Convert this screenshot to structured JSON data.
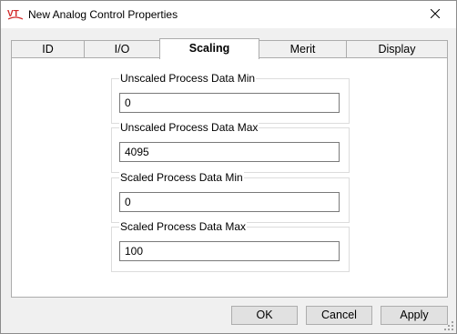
{
  "window": {
    "title": "New Analog Control Properties",
    "app_icon": "vt-logo-icon",
    "close_icon": "close-icon"
  },
  "tabs": [
    {
      "label": "ID",
      "active": false
    },
    {
      "label": "I/O",
      "active": false
    },
    {
      "label": "Scaling",
      "active": true
    },
    {
      "label": "Merit",
      "active": false
    },
    {
      "label": "Display",
      "active": false
    }
  ],
  "fields": {
    "unscaled_min": {
      "label": "Unscaled Process Data Min",
      "value": "0"
    },
    "unscaled_max": {
      "label": "Unscaled Process Data Max",
      "value": "4095"
    },
    "scaled_min": {
      "label": "Scaled Process Data Min",
      "value": "0"
    },
    "scaled_max": {
      "label": "Scaled Process Data Max",
      "value": "100"
    }
  },
  "buttons": {
    "ok": "OK",
    "cancel": "Cancel",
    "apply": "Apply"
  },
  "colors": {
    "logo_red": "#d22a2a",
    "window_bg": "#f0f0f0",
    "panel_bg": "#ffffff"
  }
}
